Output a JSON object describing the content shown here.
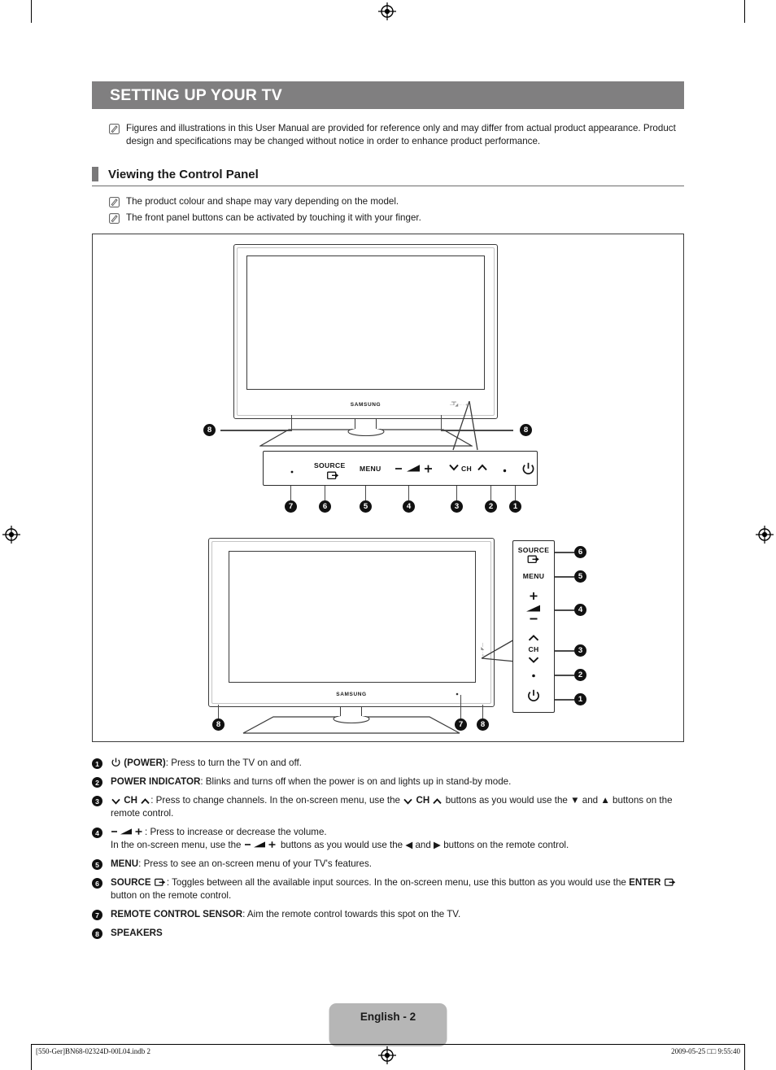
{
  "header": {
    "chapter_title": "SETTING UP YOUR TV"
  },
  "intro_notes": [
    "Figures and illustrations in this User Manual are provided for reference only and may differ from actual product appearance. Product design and specifications may be changed without notice in order to enhance product performance."
  ],
  "section": {
    "title": "Viewing the Control Panel",
    "notes": [
      "The product colour and shape may vary depending on the model.",
      "The front panel buttons can be activated by touching it with your finger."
    ]
  },
  "figure": {
    "brand_logo": "SAMSUNG",
    "front_panel_labels": {
      "source": "SOURCE",
      "menu": "MENU",
      "volume_minus": "–",
      "volume_plus": "+",
      "ch": "CH"
    },
    "front_panel_badges": [
      "7",
      "6",
      "5",
      "4",
      "3",
      "2",
      "1"
    ],
    "speaker_badges": [
      "8",
      "8"
    ],
    "side_panel_labels": {
      "source": "SOURCE",
      "menu": "MENU",
      "volume_plus": "+",
      "volume_minus": "–",
      "ch": "CH"
    },
    "side_panel_badges": [
      "6",
      "5",
      "4",
      "3",
      "2",
      "1"
    ],
    "bottom_badges": [
      "8",
      "7",
      "8"
    ]
  },
  "legend": [
    {
      "num": "1",
      "icon": "power-icon",
      "bold": "(POWER)",
      "text": ": Press to turn the TV on and off."
    },
    {
      "num": "2",
      "bold": "POWER INDICATOR",
      "text": ": Blinks and turns off when the power is on and lights up in stand-by mode."
    },
    {
      "num": "3",
      "bold_lead": "CH",
      "text": ": Press to change channels. In the on-screen menu, use the",
      "text2": "buttons as you would use the ▼ and ▲ buttons on the remote control."
    },
    {
      "num": "4",
      "text": ": Press to increase or decrease the volume.",
      "text2": "In the on-screen menu, use the",
      "text3": "buttons as you would use the ◀ and ▶ buttons on the remote control."
    },
    {
      "num": "5",
      "bold": "MENU",
      "text": ": Press to see an on-screen menu of your TV's features."
    },
    {
      "num": "6",
      "bold": "SOURCE",
      "text": ": Toggles between all the available input sources. In the on-screen menu, use this button as you would use the",
      "bold2": "ENTER",
      "text2": "button on the remote control."
    },
    {
      "num": "7",
      "bold": "REMOTE CONTROL SENSOR",
      "text": ": Aim the remote control towards this spot on the TV."
    },
    {
      "num": "8",
      "bold": "SPEAKERS",
      "text": ""
    }
  ],
  "footer": {
    "page_label": "English - 2",
    "file_ref": "[550-Ger]BN68-02324D-00L04.indb   2",
    "timestamp": "2009-05-25   □□ 9:55:40"
  },
  "colors": {
    "banner_gray": "#807f80",
    "section_bar_gray": "#7a797a",
    "page_badge_gray": "#b6b6b6",
    "ink": "#1a1a1a"
  }
}
